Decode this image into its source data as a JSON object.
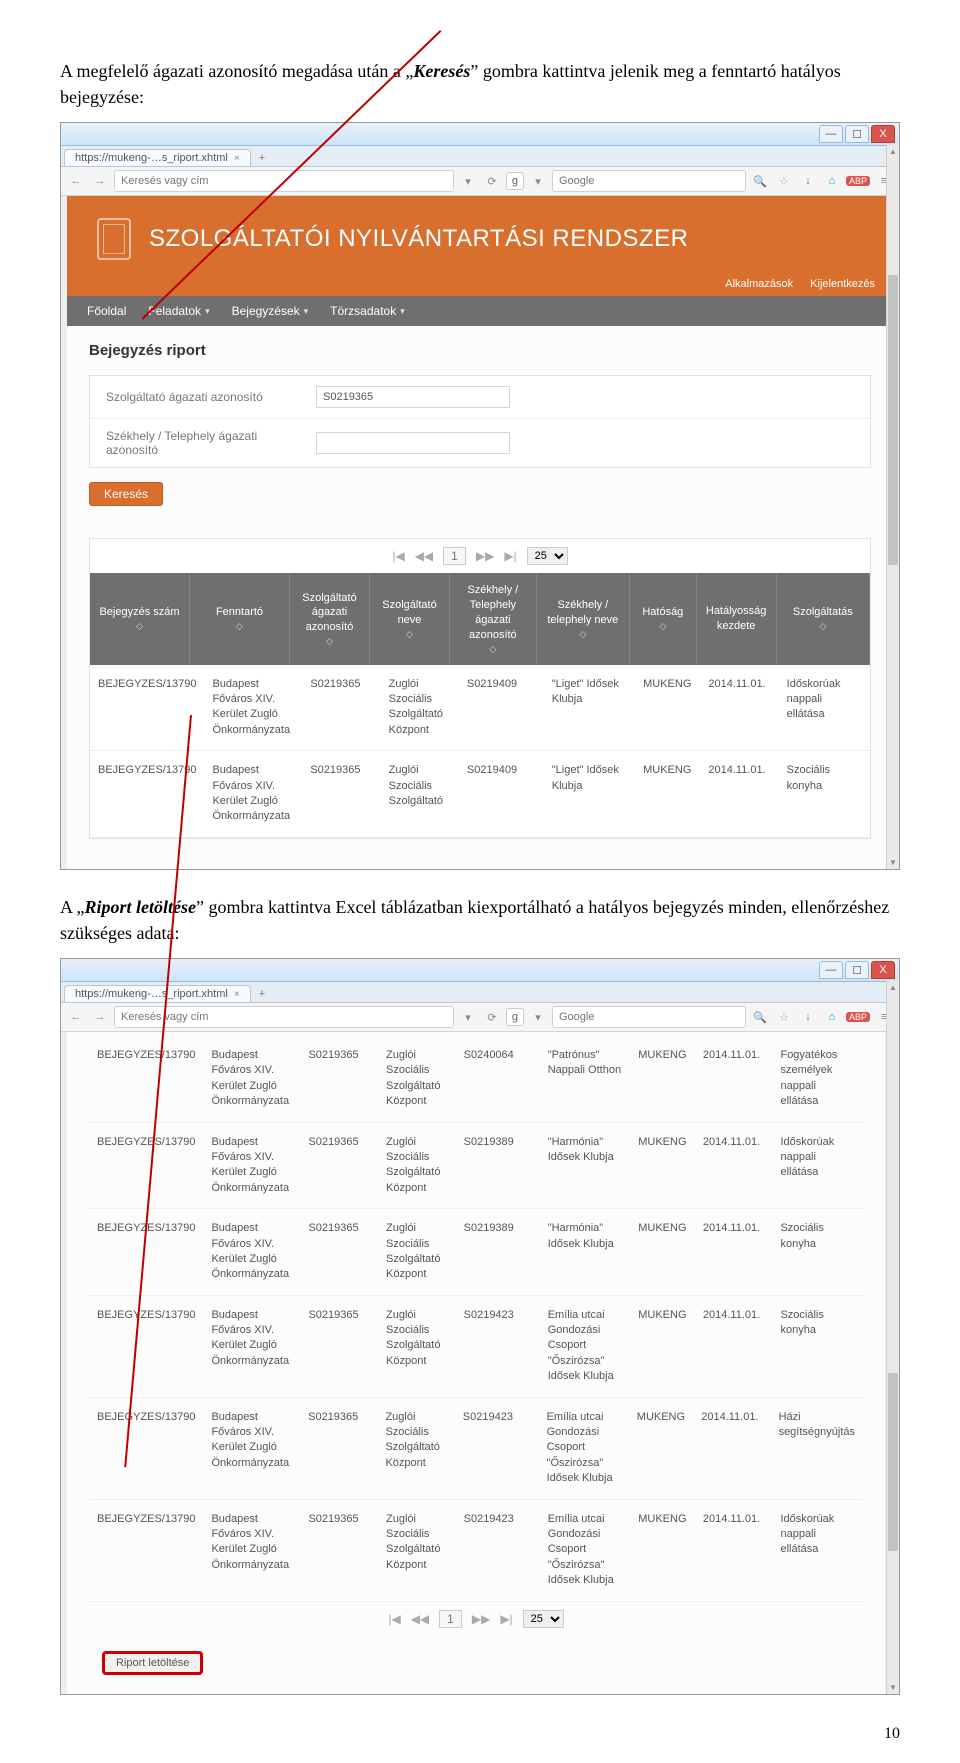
{
  "para1": {
    "pre": "A megfelelő ágazati azonosító megadása után a „",
    "emph": "Keresés",
    "post": "” gombra kattintva jelenik meg a fenntartó hatályos bejegyzése:"
  },
  "para2": {
    "pre": "A „",
    "emph": "Riport letöltése",
    "post": "” gombra kattintva Excel táblázatban kiexportálható a hatályos bejegyzés minden, ellenőrzéshez szükséges adata:"
  },
  "page_number": "10",
  "browser": {
    "tab_title": "https://mukeng-…s_riport.xhtml",
    "add_tab": "+",
    "address_placeholder": "Keresés vagy cím",
    "search_placeholder": "Google",
    "search_engine_badge": "g",
    "nav_back": "←",
    "nav_fwd": "→",
    "dropdown": "▾",
    "reload": "⟳",
    "star": "☆",
    "search_icon": "🔍",
    "dl": "↓",
    "home": "⌂",
    "abp": "ABP",
    "menu": "≡",
    "win_min": "—",
    "win_max": "☐",
    "win_close": "X"
  },
  "app": {
    "title": "SZOLGÁLTATÓI NYILVÁNTARTÁSI RENDSZER",
    "links": [
      "Alkalmazások",
      "Kijelentkezés"
    ],
    "menu": [
      "Főoldal",
      "Feladatok",
      "Bejegyzések",
      "Törzsadatok"
    ],
    "heading": "Bejegyzés riport",
    "field1_label": "Szolgáltató ágazati azonosító",
    "field1_value": "S0219365",
    "field2_label": "Székhely / Telephely ágazati azonosító",
    "field2_value": "",
    "search_btn": "Keresés",
    "pager": {
      "first": "|◀",
      "prev": "◀◀",
      "page": "1",
      "next": "▶▶",
      "last": "▶|",
      "size": "25"
    },
    "columns": [
      "Bejegyzés szám",
      "Fenntartó",
      "Szolgáltató ágazati azonosító",
      "Szolgáltató neve",
      "Székhely / Telephely ágazati azonosító",
      "Székhely / telephely neve",
      "Hatóság",
      "Hatályosság kezdete",
      "Szolgáltatás"
    ],
    "rows1": [
      [
        "BEJEGYZES/13790",
        "Budapest Főváros XIV. Kerület Zugló Önkormányzata",
        "S0219365",
        "Zuglói Szociális Szolgáltató Központ",
        "S0219409",
        "\"Liget\" Idősek Klubja",
        "MUKENG",
        "2014.11.01.",
        "Időskorúak nappali ellátása"
      ],
      [
        "BEJEGYZES/13790",
        "Budapest Főváros XIV. Kerület Zugló Önkormányzata",
        "S0219365",
        "Zuglói Szociális Szolgáltató",
        "S0219409",
        "\"Liget\" Idősek Klubja",
        "MUKENG",
        "2014.11.01.",
        "Szociális konyha"
      ]
    ],
    "rows2": [
      [
        "BEJEGYZES/13790",
        "Budapest Főváros XIV. Kerület Zugló Önkormányzata",
        "S0219365",
        "Zuglói Szociális Szolgáltató Központ",
        "S0240064",
        "\"Patrónus\" Nappali Otthon",
        "MUKENG",
        "2014.11.01.",
        "Fogyatékos személyek nappali ellátása"
      ],
      [
        "BEJEGYZES/13790",
        "Budapest Főváros XIV. Kerület Zugló Önkormányzata",
        "S0219365",
        "Zuglói Szociális Szolgáltató Központ",
        "S0219389",
        "\"Harmónia\" Idősek Klubja",
        "MUKENG",
        "2014.11.01.",
        "Időskorúak nappali ellátása"
      ],
      [
        "BEJEGYZES/13790",
        "Budapest Főváros XIV. Kerület Zugló Önkormányzata",
        "S0219365",
        "Zuglói Szociális Szolgáltató Központ",
        "S0219389",
        "\"Harmónia\" Idősek Klubja",
        "MUKENG",
        "2014.11.01.",
        "Szociális konyha"
      ],
      [
        "BEJEGYZES/13790",
        "Budapest Főváros XIV. Kerület Zugló Önkormányzata",
        "S0219365",
        "Zuglói Szociális Szolgáltató Központ",
        "S0219423",
        "Emília utcai Gondozási Csoport \"Őszirózsa\" Idősek Klubja",
        "MUKENG",
        "2014.11.01.",
        "Szociális konyha"
      ],
      [
        "BEJEGYZES/13790",
        "Budapest Főváros XIV. Kerület Zugló Önkormányzata",
        "S0219365",
        "Zuglói Szociális Szolgáltató Központ",
        "S0219423",
        "Emília utcai Gondozási Csoport \"Őszirózsa\" Idősek Klubja",
        "MUKENG",
        "2014.11.01.",
        "Házi segítségnyújtás"
      ],
      [
        "BEJEGYZES/13790",
        "Budapest Főváros XIV. Kerület Zugló Önkormányzata",
        "S0219365",
        "Zuglói Szociális Szolgáltató Központ",
        "S0219423",
        "Emília utcai Gondozási Csoport \"Őszirózsa\" Idősek Klubja",
        "MUKENG",
        "2014.11.01.",
        "Időskorúak nappali ellátása"
      ]
    ],
    "riport_btn": "Riport letöltése"
  }
}
